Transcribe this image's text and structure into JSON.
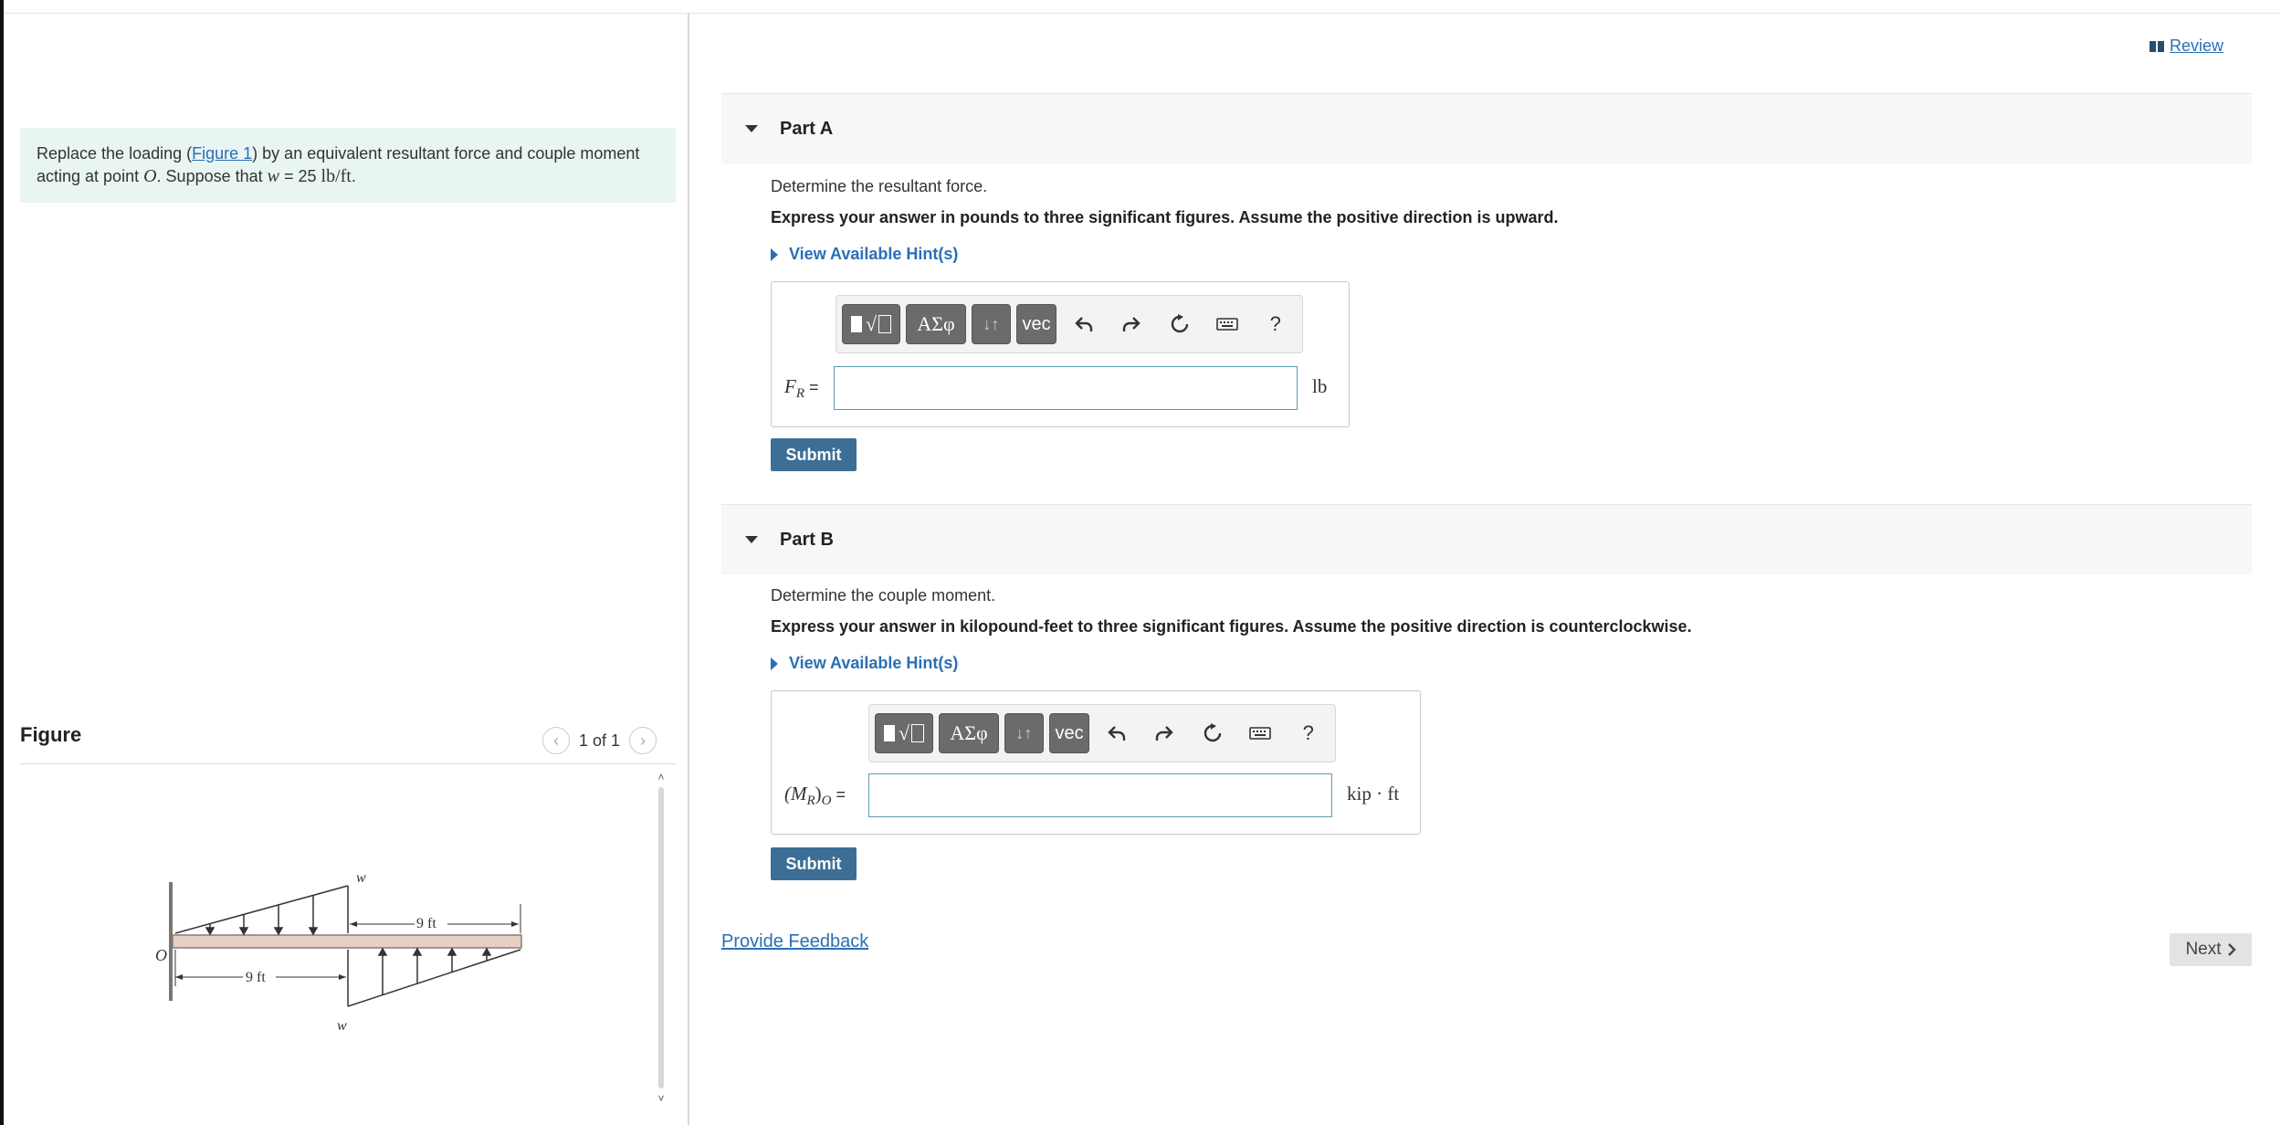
{
  "problem": {
    "prefix": "Replace the loading (",
    "figure_link": "Figure 1",
    "middle": ") by an equivalent resultant force and couple moment",
    "line2_a": "acting at point ",
    "point": "O",
    "line2_b": ". Suppose that ",
    "var_w": "w",
    "eq_value": " = 25 ",
    "unit": "lb/ft",
    "end": "."
  },
  "figure": {
    "title": "Figure",
    "counter": "1 of 1",
    "labels": {
      "o": "O",
      "w_top": "w",
      "w_bottom": "w",
      "dim_top": "9 ft",
      "dim_bottom": "9 ft"
    }
  },
  "header": {
    "review": "Review"
  },
  "part_a": {
    "title": "Part A",
    "question": "Determine the resultant force.",
    "instruction": "Express your answer in pounds to three significant figures. Assume the positive direction is upward.",
    "hint": "View Available Hint(s)",
    "label": "F",
    "label_sub": "R",
    "label_eq": " =",
    "unit": "lb",
    "value": "",
    "submit": "Submit"
  },
  "part_b": {
    "title": "Part B",
    "question": "Determine the couple moment.",
    "instruction": "Express your answer in kilopound-feet to three significant figures. Assume the positive direction is counterclockwise.",
    "hint": "View Available Hint(s)",
    "label_open": "(M",
    "label_sub": "R",
    "label_close": ")",
    "label_sub2": "O",
    "label_eq": " =",
    "unit": "kip · ft",
    "value": "",
    "submit": "Submit"
  },
  "toolbar": {
    "templates": "√",
    "greek": "ΑΣφ",
    "updown": "↓↑",
    "vec": "vec",
    "help": "?"
  },
  "footer": {
    "feedback": "Provide Feedback",
    "next": "Next"
  },
  "icons": [
    "book-icon",
    "caret-down-icon",
    "caret-right-icon",
    "undo-icon",
    "redo-icon",
    "reset-icon",
    "keyboard-icon",
    "chevron-left-icon",
    "chevron-right-icon"
  ]
}
